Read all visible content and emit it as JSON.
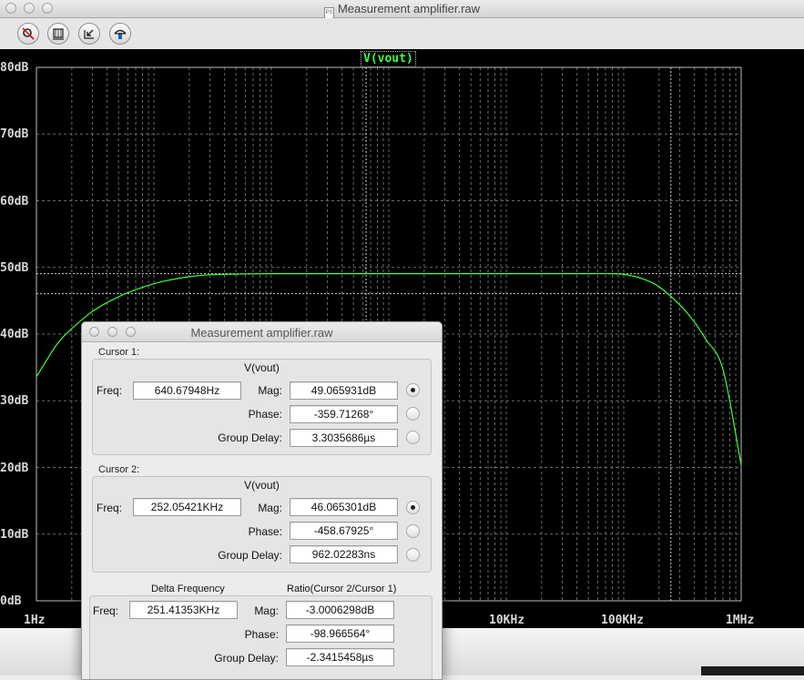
{
  "window": {
    "title": "Measurement amplifier.raw"
  },
  "toolbar": {
    "buttons": [
      {
        "name": "probe-icon"
      },
      {
        "name": "zoom-area-icon"
      },
      {
        "name": "zoom-back-icon"
      },
      {
        "name": "autorange-icon"
      }
    ]
  },
  "plot": {
    "trace_label": "V(vout)",
    "trace_color": "#3cff3c",
    "background": "#000000",
    "grid_color": "#6a6a6a",
    "y_tick_labels": [
      "80dB",
      "70dB",
      "60dB",
      "50dB",
      "40dB",
      "30dB",
      "20dB",
      "10dB",
      "0dB"
    ],
    "x_tick_labels": [
      "1Hz",
      "10KHz",
      "100KHz",
      "1MHz"
    ]
  },
  "chart_data": {
    "type": "line",
    "x_scale": "log",
    "xlim": [
      1,
      1000000
    ],
    "ylim": [
      0,
      80
    ],
    "y_ticks": [
      0,
      10,
      20,
      30,
      40,
      50,
      60,
      70,
      80
    ],
    "x_ticks": [
      1,
      10000,
      100000,
      1000000
    ],
    "grid": true,
    "series": [
      {
        "name": "V(vout)",
        "x": [
          1,
          1.5,
          2,
          3,
          5,
          8,
          12,
          20,
          30,
          50,
          100,
          300,
          1000,
          10000,
          50000,
          80000,
          100000,
          120000,
          150000,
          200000,
          300000,
          400000,
          500000,
          700000,
          1000000
        ],
        "y": [
          33.6,
          38.5,
          40.8,
          43.4,
          45.6,
          47.0,
          47.9,
          48.6,
          48.9,
          49.0,
          49.06,
          49.07,
          49.07,
          49.07,
          49.07,
          49.06,
          48.95,
          48.7,
          48.2,
          47.1,
          44.4,
          41.8,
          39.2,
          34.7,
          20.3
        ]
      }
    ],
    "cursors": [
      {
        "freq_hz": 640.67948,
        "mag_db": 49.065931
      },
      {
        "freq_hz": 252054.21,
        "mag_db": 46.065301
      }
    ]
  },
  "dialog": {
    "title": "Measurement amplifier.raw",
    "cursor1": {
      "caption": "Cursor 1:",
      "trace": "V(vout)",
      "freq_label": "Freq:",
      "freq": "640.67948Hz",
      "mag_label": "Mag:",
      "mag": "49.065931dB",
      "phase_label": "Phase:",
      "phase": "-359.71268°",
      "gd_label": "Group Delay:",
      "gd": "3.3035686µs"
    },
    "cursor2": {
      "caption": "Cursor 2:",
      "trace": "V(vout)",
      "freq_label": "Freq:",
      "freq": "252.05421KHz",
      "mag_label": "Mag:",
      "mag": "46.065301dB",
      "phase_label": "Phase:",
      "phase": "-458.67925°",
      "gd_label": "Group Delay:",
      "gd": "962.02283ns"
    },
    "delta": {
      "caption_left": "Delta Frequency",
      "caption_right": "Ratio(Cursor 2/Cursor 1)",
      "freq_label": "Freq:",
      "freq": "251.41353KHz",
      "mag_label": "Mag:",
      "mag": "-3.0006298dB",
      "phase_label": "Phase:",
      "phase": "-98.966564°",
      "gd_label": "Group Delay:",
      "gd": "-2.3415458µs"
    }
  }
}
